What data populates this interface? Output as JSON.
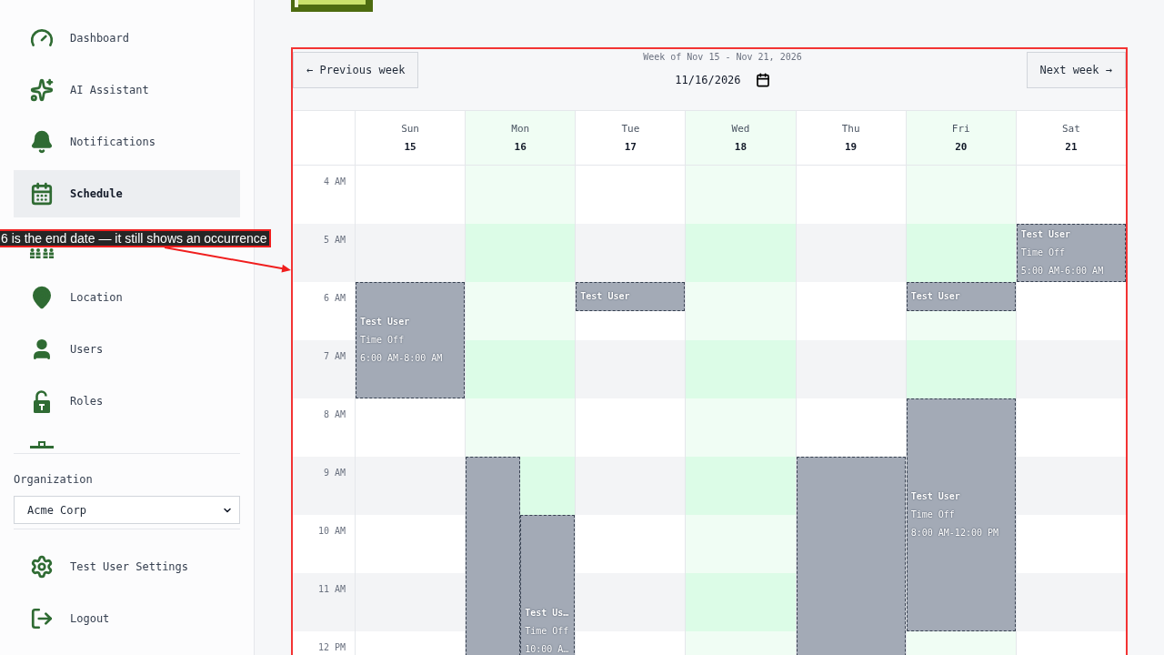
{
  "sidebar": {
    "nav_items": [
      {
        "label": "Dashboard",
        "selected": false
      },
      {
        "label": "AI Assistant",
        "selected": false
      },
      {
        "label": "Notifications",
        "selected": false
      },
      {
        "label": "Schedule",
        "selected": true
      },
      {
        "selected": false
      },
      {
        "label": "Location",
        "selected": false
      },
      {
        "label": "Users",
        "selected": false
      },
      {
        "label": "Roles",
        "selected": false
      }
    ],
    "organization": {
      "label": "Organization",
      "value": "Acme Corp"
    },
    "account_items": [
      {
        "label": "Test User Settings"
      },
      {
        "label": "Logout"
      }
    ]
  },
  "calendar": {
    "prev_button": "← Previous week",
    "week_range": "Week of Nov 15 - Nov 21, 2026",
    "date_input": {
      "value": "11/16/2026"
    },
    "next_button": "Next week →",
    "hours": [
      "4 AM",
      "5 AM",
      "6 AM",
      "7 AM",
      "8 AM",
      "9 AM",
      "10 AM",
      "11 AM",
      "12 PM"
    ],
    "days": [
      {
        "name": "Sun",
        "date": "15",
        "highlighted": false,
        "cells": [
          {
            "highlighted": false
          },
          {
            "highlighted": false
          },
          {
            "events": [
              {
                "kind": "two-hours",
                "name": "Test User",
                "label": "Time Off",
                "time": "6:00 AM-8:00 AM"
              }
            ]
          },
          {
            "highlighted": false
          },
          {
            "highlighted": false
          },
          {
            "highlighted": false
          },
          {
            "highlighted": false
          },
          {
            "highlighted": false
          }
        ]
      },
      {
        "name": "Mon",
        "date": "16",
        "highlighted": true,
        "cells": [
          {
            "highlighted": true
          },
          {
            "highlighted": true
          },
          {
            "highlighted": true
          },
          {
            "highlighted": true
          },
          {
            "highlighted": true
          },
          {
            "highlighted": true,
            "events": [
              {
                "kind": "open"
              }
            ]
          },
          {
            "events": [
              {
                "kind": "open",
                "name": "Test Us…",
                "label": "Time Off",
                "time": "10:00 A…"
              }
            ]
          }
        ]
      },
      {
        "name": "Tue",
        "date": "17",
        "highlighted": false,
        "cells": [
          {
            "highlighted": false
          },
          {
            "highlighted": false
          },
          {
            "highlighted": false,
            "events": [
              {
                "kind": "half-hour",
                "name": "Test User"
              }
            ]
          },
          {
            "highlighted": false
          },
          {
            "highlighted": false
          },
          {
            "highlighted": false
          },
          {
            "highlighted": false
          },
          {
            "highlighted": false
          },
          {
            "highlighted": false
          }
        ]
      },
      {
        "name": "Wed",
        "date": "18",
        "highlighted": true,
        "cells": [
          {
            "highlighted": true
          },
          {
            "highlighted": true
          },
          {
            "highlighted": true
          },
          {
            "highlighted": true
          },
          {
            "highlighted": true
          },
          {
            "highlighted": true
          },
          {
            "highlighted": true
          },
          {
            "highlighted": true
          },
          {
            "highlighted": true
          }
        ]
      },
      {
        "name": "Thu",
        "date": "19",
        "highlighted": false,
        "cells": [
          {
            "highlighted": false
          },
          {
            "highlighted": false
          },
          {
            "highlighted": false
          },
          {
            "highlighted": false
          },
          {
            "highlighted": false
          },
          {
            "events": [
              {
                "kind": "open"
              }
            ]
          }
        ]
      },
      {
        "name": "Fri",
        "date": "20",
        "highlighted": true,
        "cells": [
          {
            "highlighted": true
          },
          {
            "highlighted": true
          },
          {
            "highlighted": true,
            "events": [
              {
                "kind": "half-hour",
                "name": "Test User"
              }
            ]
          },
          {
            "highlighted": true
          },
          {
            "events": [
              {
                "kind": "four-hours",
                "name": "Test User",
                "label": "Time Off",
                "time": "8:00 AM-12:00 PM"
              }
            ]
          },
          {
            "highlighted": true
          }
        ]
      },
      {
        "name": "Sat",
        "date": "21",
        "highlighted": false,
        "cells": [
          {
            "highlighted": false
          },
          {
            "events": [
              {
                "kind": "one-hour",
                "name": "Test User",
                "label": "Time Off",
                "time": "5:00 AM-6:00 AM"
              }
            ]
          },
          {
            "highlighted": false
          },
          {
            "highlighted": false
          },
          {
            "highlighted": false
          },
          {
            "highlighted": false
          },
          {
            "highlighted": false
          },
          {
            "highlighted": false
          },
          {
            "highlighted": false
          }
        ]
      }
    ]
  },
  "annotation": {
    "text": "6 is the end date — it still shows an occurrence"
  }
}
